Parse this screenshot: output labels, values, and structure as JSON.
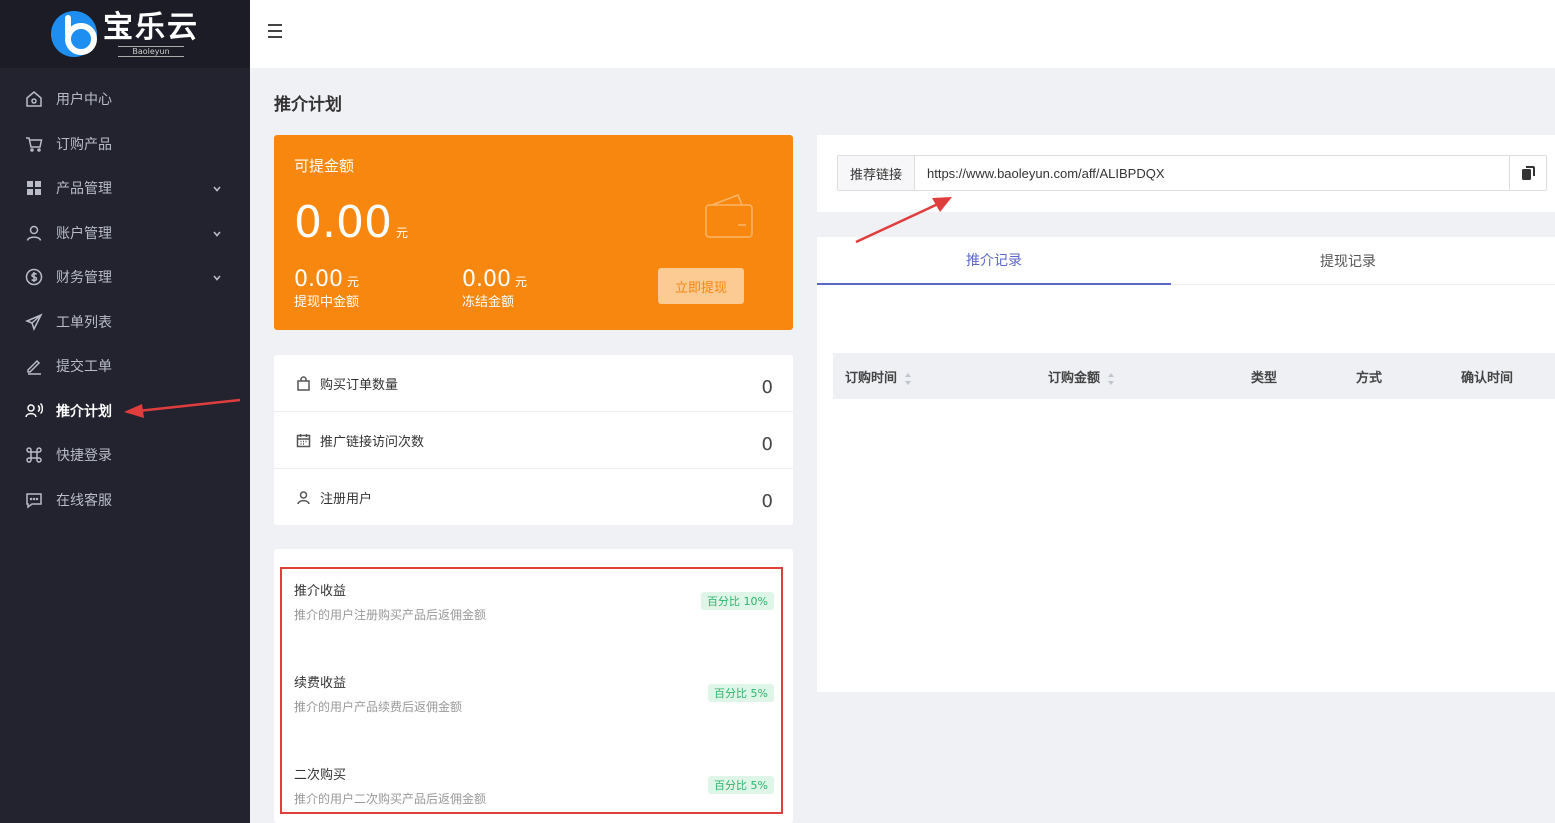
{
  "brand": {
    "name_cn": "宝乐云",
    "name_en": "Baoleyun"
  },
  "sidebar": {
    "items": [
      {
        "label": "用户中心",
        "icon": "home-icon"
      },
      {
        "label": "订购产品",
        "icon": "cart-icon"
      },
      {
        "label": "产品管理",
        "icon": "grid-icon",
        "expandable": true
      },
      {
        "label": "账户管理",
        "icon": "user-icon",
        "expandable": true
      },
      {
        "label": "财务管理",
        "icon": "dollar-icon",
        "expandable": true
      },
      {
        "label": "工单列表",
        "icon": "send-icon"
      },
      {
        "label": "提交工单",
        "icon": "pen-icon"
      },
      {
        "label": "推介计划",
        "icon": "referral-icon",
        "active": true
      },
      {
        "label": "快捷登录",
        "icon": "command-icon"
      },
      {
        "label": "在线客服",
        "icon": "chat-icon"
      }
    ]
  },
  "page": {
    "title": "推介计划"
  },
  "balance": {
    "label": "可提金额",
    "amount": "0.00",
    "unit": "元",
    "pending_amount": "0.00",
    "pending_unit": "元",
    "pending_label": "提现中金额",
    "frozen_amount": "0.00",
    "frozen_unit": "元",
    "frozen_label": "冻结金额",
    "withdraw_label": "立即提现",
    "accent_color": "#f7870e"
  },
  "stats": [
    {
      "label": "购买订单数量",
      "value": "0",
      "icon": "bag-icon"
    },
    {
      "label": "推广链接访问次数",
      "value": "0",
      "icon": "calendar-icon"
    },
    {
      "label": "注册用户",
      "value": "0",
      "icon": "user-icon"
    }
  ],
  "commissions": [
    {
      "title": "推介收益",
      "desc": "推介的用户注册购买产品后返佣金额",
      "badge": "百分比 10%"
    },
    {
      "title": "续费收益",
      "desc": "推介的用户产品续费后返佣金额",
      "badge": "百分比 5%"
    },
    {
      "title": "二次购买",
      "desc": "推介的用户二次购买产品后返佣金额",
      "badge": "百分比 5%"
    }
  ],
  "referral_link": {
    "label": "推荐链接",
    "value": "https://www.baoleyun.com/aff/ALIBPDQX"
  },
  "tabs": [
    {
      "label": "推介记录",
      "active": true
    },
    {
      "label": "提现记录"
    }
  ],
  "table": {
    "columns": [
      {
        "label": "订购时间",
        "sortable": true
      },
      {
        "label": "订购金额",
        "sortable": true
      },
      {
        "label": "类型"
      },
      {
        "label": "方式"
      },
      {
        "label": "确认时间"
      }
    ]
  },
  "colors": {
    "sidebar": "#22232f",
    "primary": "#5b68c9",
    "annotation": "#e03d3d",
    "badge_green": "#2cb56d"
  }
}
